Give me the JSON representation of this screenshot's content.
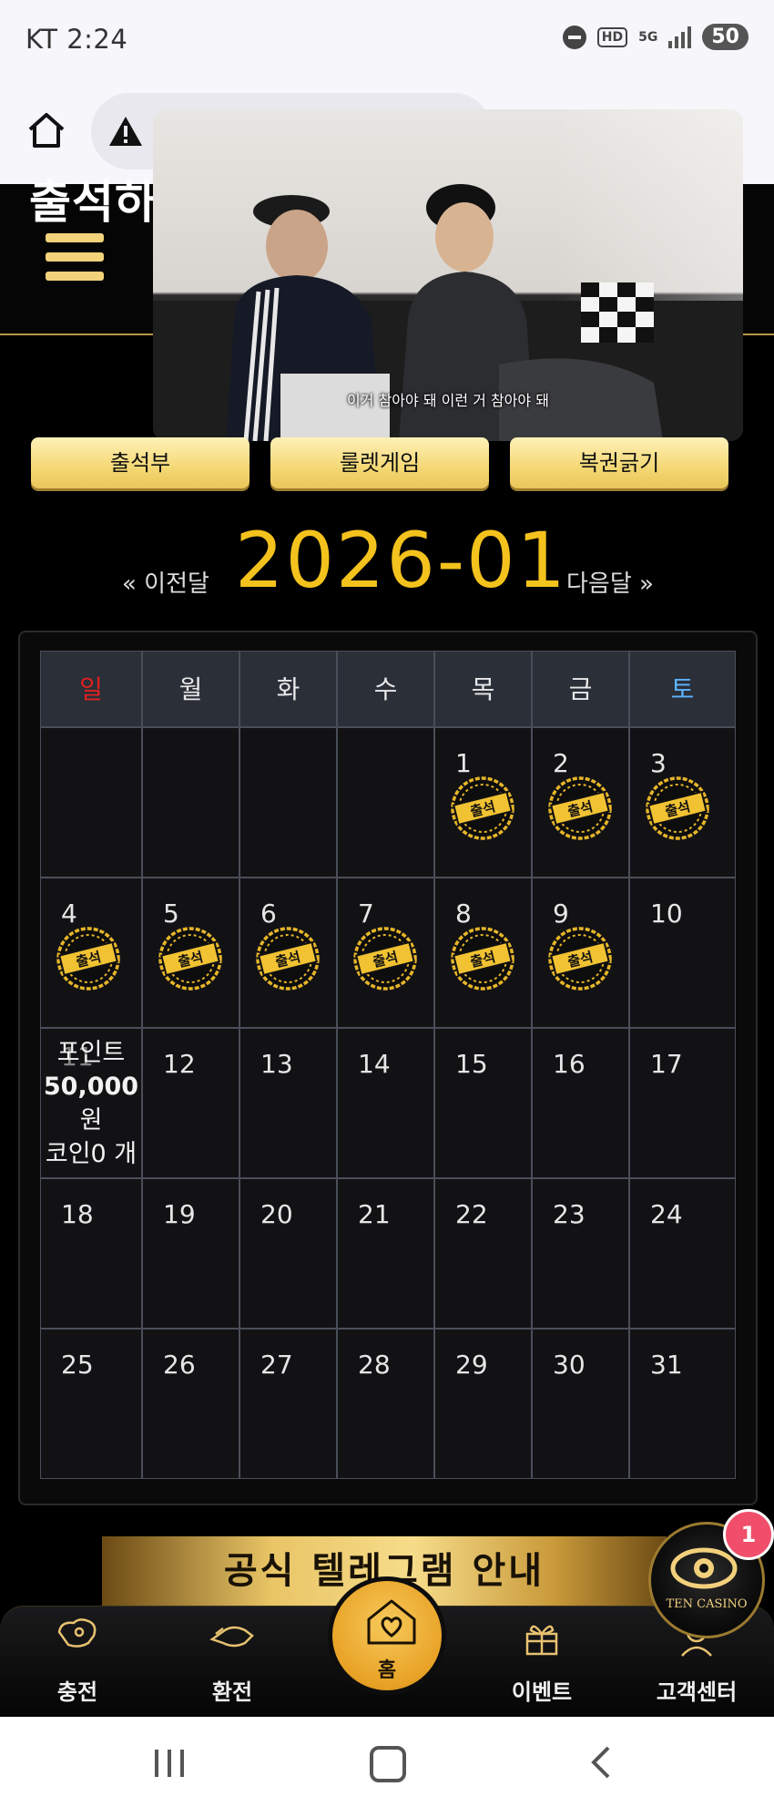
{
  "status_bar": {
    "carrier_time": "KT 2:24",
    "hd": "HD",
    "network": "5G",
    "battery": "50"
  },
  "page": {
    "title": "출석하"
  },
  "video": {
    "subtitle": "이거 참아야 돼 이런 거 참아야 돼"
  },
  "tabs": [
    "출석부",
    "룰렛게임",
    "복권긁기"
  ],
  "month_nav": {
    "prev": "« 이전달",
    "current": "2026-01",
    "next": "다음달 »"
  },
  "calendar": {
    "weekdays": [
      "일",
      "월",
      "화",
      "수",
      "목",
      "금",
      "토"
    ],
    "weekday_colors": {
      "sunday": "#e02020",
      "saturday": "#5db4ff"
    },
    "stamp_text": "출석",
    "weeks": [
      [
        "",
        "",
        "",
        "",
        "1",
        "2",
        "3"
      ],
      [
        "4",
        "5",
        "6",
        "7",
        "8",
        "9",
        "10"
      ],
      [
        "11",
        "12",
        "13",
        "14",
        "15",
        "16",
        "17"
      ],
      [
        "18",
        "19",
        "20",
        "21",
        "22",
        "23",
        "24"
      ],
      [
        "25",
        "26",
        "27",
        "28",
        "29",
        "30",
        "31"
      ]
    ],
    "attended_days": [
      "1",
      "2",
      "3",
      "4",
      "5",
      "6",
      "7",
      "8",
      "9"
    ],
    "bonus_cell": {
      "day": "11",
      "point_label": "포인트",
      "point_value": "50,000",
      "point_unit": "원",
      "coin_label": "코인0 개"
    }
  },
  "banner": {
    "text": "공식 텔레그램 안내"
  },
  "bottom_nav": {
    "items": [
      {
        "label": "충전",
        "icon": "deposit-icon"
      },
      {
        "label": "환전",
        "icon": "withdraw-icon"
      },
      {
        "label": "홈",
        "icon": "home-heart-icon"
      },
      {
        "label": "이벤트",
        "icon": "gift-icon"
      },
      {
        "label": "고객센터",
        "icon": "support-icon"
      }
    ]
  },
  "casino_badge": {
    "text": "TEN CASINO",
    "notification_count": "1"
  },
  "colors": {
    "accent_gold": "#f4c21d",
    "button_gold": "#f4d874",
    "background": "#000000"
  }
}
